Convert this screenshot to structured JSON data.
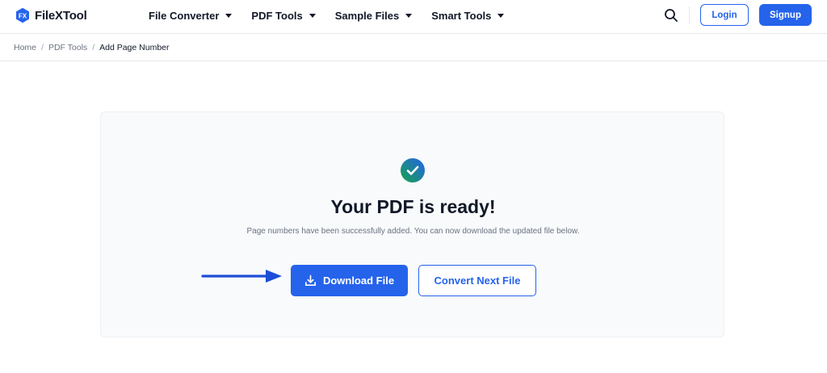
{
  "header": {
    "logo": {
      "badge": "FX",
      "text": "FileXTool"
    },
    "nav": [
      {
        "label": "File Converter"
      },
      {
        "label": "PDF Tools"
      },
      {
        "label": "Sample Files"
      },
      {
        "label": "Smart Tools"
      }
    ],
    "login_label": "Login",
    "signup_label": "Signup"
  },
  "breadcrumb": {
    "items": [
      "Home",
      "PDF Tools",
      "Add Page Number"
    ],
    "separator": "/"
  },
  "result": {
    "title": "Your PDF is ready!",
    "message": "Page numbers have been successfully added. You can now download the updated file below.",
    "download_label": "Download File",
    "next_label": "Convert Next File"
  },
  "colors": {
    "accent": "#2563eb",
    "text": "#111827",
    "muted": "#6b7280",
    "card_bg": "#f8fafc",
    "check_gradient_start": "#16a34a",
    "check_gradient_end": "#2563eb"
  },
  "icons": {
    "logo": "fx-badge-icon",
    "search": "search-icon",
    "success": "check-circle-icon",
    "download": "download-icon",
    "pointer": "arrow-right-icon"
  }
}
